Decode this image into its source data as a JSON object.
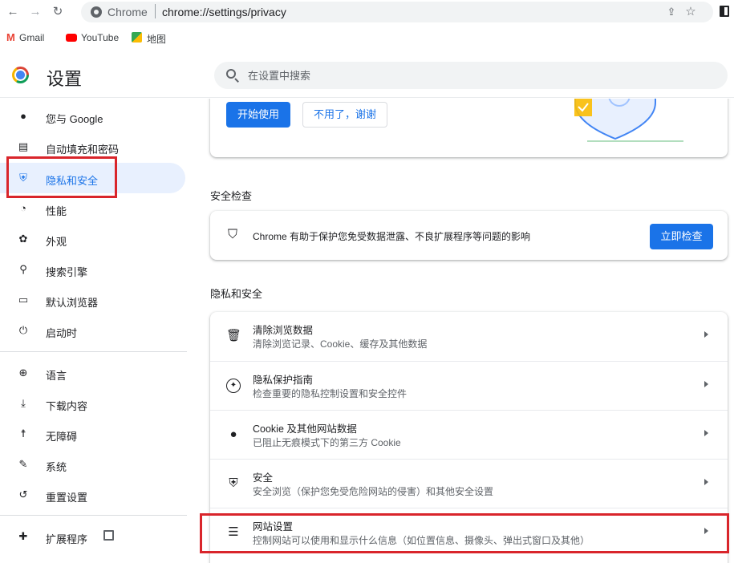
{
  "browser": {
    "origin": "Chrome",
    "url": "chrome://settings/privacy",
    "bookmarks": [
      "Gmail",
      "YouTube",
      "地图"
    ]
  },
  "header": {
    "title": "设置",
    "search_placeholder": "在设置中搜索"
  },
  "sidebar": {
    "items": [
      {
        "label": "您与 Google",
        "icon": "person-icon"
      },
      {
        "label": "自动填充和密码",
        "icon": "clipboard-icon"
      },
      {
        "label": "隐私和安全",
        "icon": "shield-icon",
        "active": true
      },
      {
        "label": "性能",
        "icon": "speedometer-icon"
      },
      {
        "label": "外观",
        "icon": "palette-icon"
      },
      {
        "label": "搜索引擎",
        "icon": "search-icon"
      },
      {
        "label": "默认浏览器",
        "icon": "browser-icon"
      },
      {
        "label": "启动时",
        "icon": "power-icon"
      },
      {
        "label": "语言",
        "icon": "globe-icon"
      },
      {
        "label": "下载内容",
        "icon": "download-icon"
      },
      {
        "label": "无障碍",
        "icon": "accessibility-icon"
      },
      {
        "label": "系统",
        "icon": "wrench-icon"
      },
      {
        "label": "重置设置",
        "icon": "reset-icon"
      },
      {
        "label": "扩展程序",
        "icon": "puzzle-icon"
      }
    ]
  },
  "promo": {
    "primary_label": "开始使用",
    "secondary_label": "不用了，谢谢"
  },
  "safety_check": {
    "section_title": "安全检查",
    "text": "Chrome 有助于保护您免受数据泄露、不良扩展程序等问题的影响",
    "button_label": "立即检查"
  },
  "privacy": {
    "section_title": "隐私和安全",
    "rows": [
      {
        "title": "清除浏览数据",
        "subtitle": "清除浏览记录、Cookie、缓存及其他数据",
        "icon": "trash-icon"
      },
      {
        "title": "隐私保护指南",
        "subtitle": "检查重要的隐私控制设置和安全控件",
        "icon": "compass-icon"
      },
      {
        "title": "Cookie 及其他网站数据",
        "subtitle": "已阻止无痕模式下的第三方 Cookie",
        "icon": "cookie-icon"
      },
      {
        "title": "安全",
        "subtitle": "安全浏览（保护您免受危险网站的侵害）和其他安全设置",
        "icon": "security-shield-icon"
      },
      {
        "title": "网站设置",
        "subtitle": "控制网站可以使用和显示什么信息（如位置信息、摄像头、弹出式窗口及其他）",
        "icon": "tune-icon"
      }
    ]
  },
  "colors": {
    "accent": "#1a73e8",
    "active_bg": "#e8f0fe",
    "highlight": "#d9252b"
  }
}
